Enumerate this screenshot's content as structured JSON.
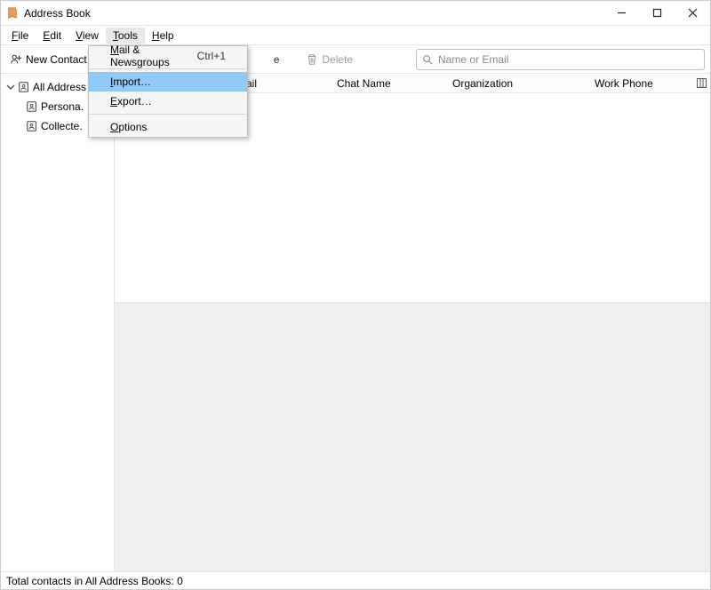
{
  "window": {
    "title": "Address Book"
  },
  "menubar": {
    "file": "File",
    "edit": "Edit",
    "view": "View",
    "tools": "Tools",
    "help": "Help"
  },
  "toolbar": {
    "new_contact": "New Contact",
    "delete": "Delete",
    "search_placeholder": "Name or Email",
    "hidden_write_e": "e"
  },
  "tools_menu": {
    "mail_newsgroups": "Mail & Newsgroups",
    "mail_newsgroups_shortcut": "Ctrl+1",
    "import": "Import…",
    "export": "Export…",
    "options": "Options"
  },
  "sidebar": {
    "all": "All Address",
    "personal": "Persona.",
    "collected": "Collecte."
  },
  "columns": {
    "email": "Email",
    "chat": "Chat Name",
    "org": "Organization",
    "work": "Work Phone"
  },
  "statusbar": {
    "text": "Total contacts in All Address Books: 0"
  }
}
